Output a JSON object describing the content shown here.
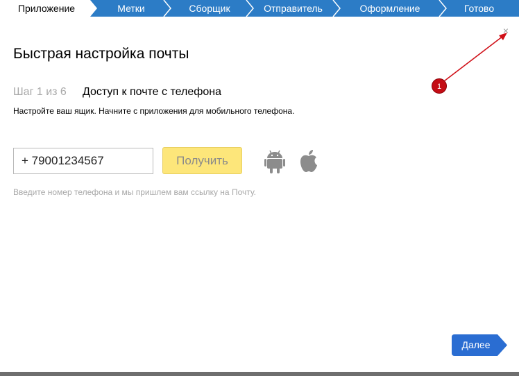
{
  "tabs": [
    {
      "label": "Приложение",
      "active": true
    },
    {
      "label": "Метки",
      "active": false
    },
    {
      "label": "Сборщик",
      "active": false
    },
    {
      "label": "Отправитель",
      "active": false
    },
    {
      "label": "Оформление",
      "active": false
    },
    {
      "label": "Готово",
      "active": false
    }
  ],
  "dialog": {
    "close_symbol": "×",
    "title": "Быстрая настройка почты",
    "step_number": "Шаг 1 из 6",
    "step_title": "Доступ к почте с телефона",
    "description": "Настройте ваш ящик. Начните с приложения для мобильного телефона.",
    "phone_value": "+ 79001234567",
    "get_button": "Получить",
    "hint": "Введите номер телефона и мы пришлем вам ссылку на Почту.",
    "next_button": "Далее"
  },
  "annotation": {
    "badge": "1"
  },
  "icons": {
    "android": "android-icon",
    "apple": "apple-icon",
    "close": "close-icon"
  },
  "colors": {
    "tab_bar": "#2c7cc6",
    "active_tab": "#ffffff",
    "get_button": "#fde67a",
    "next_button": "#2a6dd2",
    "annotation": "#c40c14"
  }
}
